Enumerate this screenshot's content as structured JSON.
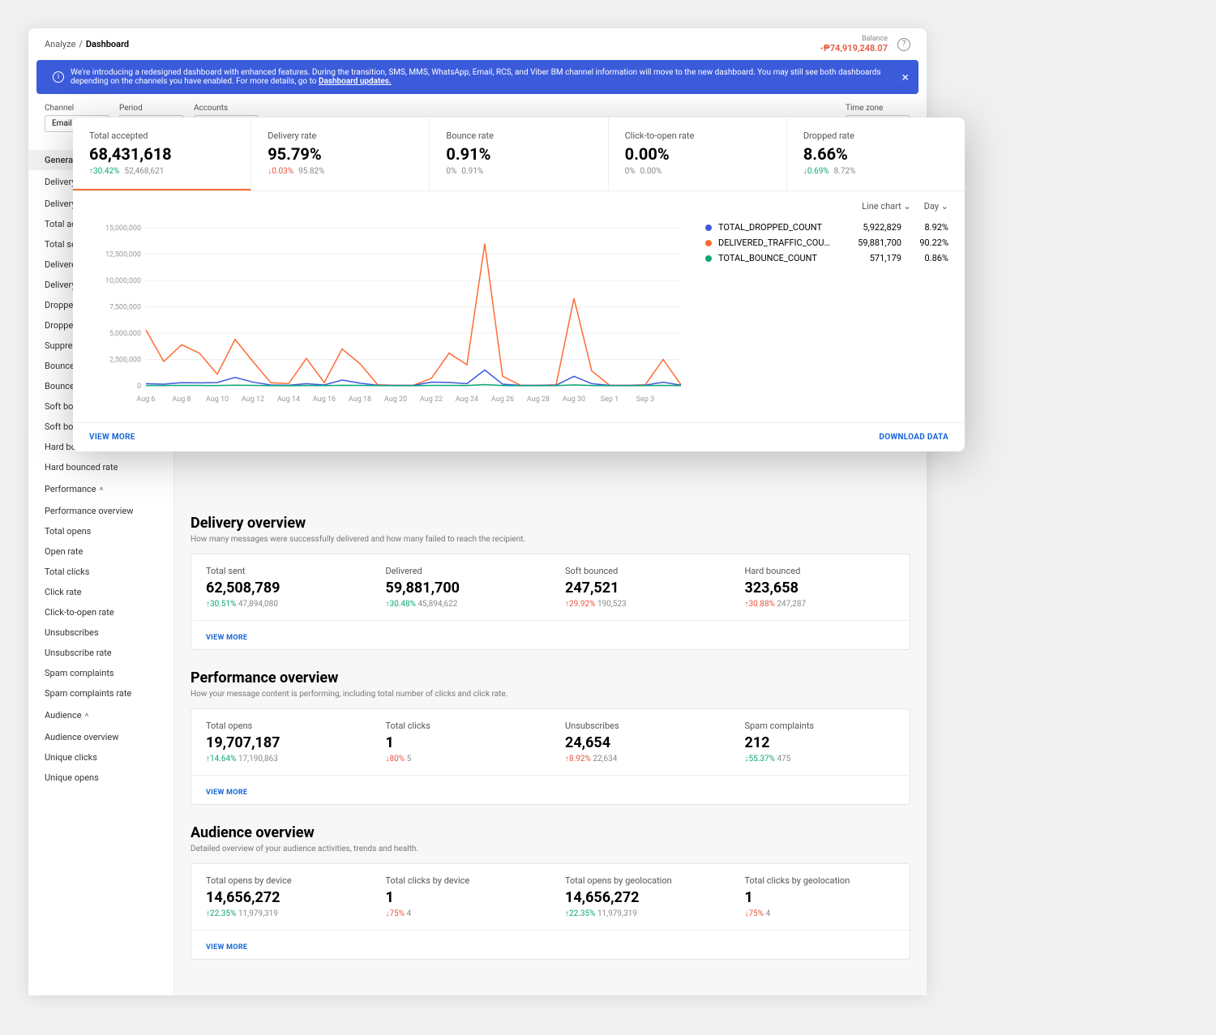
{
  "breadcrumb": {
    "parent": "Analyze",
    "current": "Dashboard"
  },
  "balance": {
    "label": "Balance",
    "value": "-₱74,919,248.07"
  },
  "banner": {
    "text": "We're introducing a redesigned dashboard with enhanced features. During the transition, SMS, MMS, WhatsApp, Email, RCS, and Viber BM channel information will move to the new dashboard. You may still see both dashboards depending on the channels you have enabled. For more details, go to ",
    "link": "Dashboard updates."
  },
  "filters": {
    "channel_label": "Channel",
    "channel_value": "Email",
    "period_label": "Period",
    "accounts_label": "Accounts",
    "tz_label": "Time zone"
  },
  "sidebar": {
    "general": "General overview",
    "g_delivery": "Delivery",
    "items_delivery": [
      "Delivery overview",
      "Total accepted",
      "Total sent",
      "Delivered",
      "Delivery rate",
      "Dropped",
      "Dropped rate",
      "Suppressed",
      "Bounced",
      "Bounced rate",
      "Soft bounced",
      "Soft bounced rate",
      "Hard bounced",
      "Hard bounced rate"
    ],
    "g_performance": "Performance",
    "items_performance": [
      "Performance overview",
      "Total opens",
      "Open rate",
      "Total clicks",
      "Click rate",
      "Click-to-open rate",
      "Unsubscribes",
      "Unsubscribe rate",
      "Spam complaints",
      "Spam complaints rate"
    ],
    "g_audience": "Audience",
    "items_audience": [
      "Audience overview",
      "Unique clicks",
      "Unique opens"
    ]
  },
  "kpis": [
    {
      "label": "Total accepted",
      "value": "68,431,618",
      "delta": "↑30.42%",
      "dir": "up",
      "prev": "52,468,621"
    },
    {
      "label": "Delivery rate",
      "value": "95.79%",
      "delta": "↓0.03%",
      "dir": "down",
      "prev": "95.82%"
    },
    {
      "label": "Bounce rate",
      "value": "0.91%",
      "delta": "0%",
      "dir": "flat",
      "prev": "0.91%"
    },
    {
      "label": "Click-to-open rate",
      "value": "0.00%",
      "delta": "0%",
      "dir": "flat",
      "prev": "0.00%"
    },
    {
      "label": "Dropped rate",
      "value": "8.66%",
      "delta": "↓0.69%",
      "dir": "up",
      "prev": "8.72%"
    }
  ],
  "chart_controls": {
    "type": "Line chart",
    "granularity": "Day"
  },
  "legend": [
    {
      "color": "#3b5bdb",
      "name": "TOTAL_DROPPED_COUNT",
      "val": "5,922,829",
      "pct": "8.92%"
    },
    {
      "color": "#ff6b35",
      "name": "DELIVERED_TRAFFIC_COU...",
      "val": "59,881,700",
      "pct": "90.22%"
    },
    {
      "color": "#0ca678",
      "name": "TOTAL_BOUNCE_COUNT",
      "val": "571,179",
      "pct": "0.86%"
    }
  ],
  "chart_footer": {
    "view": "VIEW MORE",
    "download": "DOWNLOAD DATA"
  },
  "chart_data": {
    "type": "line",
    "title": "",
    "xlabel": "",
    "ylabel": "",
    "ylim": [
      0,
      15000000
    ],
    "yticks": [
      "0",
      "2,500,000",
      "5,000,000",
      "7,500,000",
      "10,000,000",
      "12,500,000",
      "15,000,000"
    ],
    "categories": [
      "Aug 6",
      "Aug 8",
      "Aug 10",
      "Aug 12",
      "Aug 14",
      "Aug 16",
      "Aug 18",
      "Aug 20",
      "Aug 22",
      "Aug 24",
      "Aug 26",
      "Aug 28",
      "Aug 30",
      "Sep 1",
      "Sep 3"
    ],
    "series": [
      {
        "name": "DELIVERED_TRAFFIC_COUNT",
        "color": "#ff6b35",
        "values": [
          5300000,
          2300000,
          3900000,
          3100000,
          1100000,
          4400000,
          2300000,
          300000,
          200000,
          2600000,
          300000,
          3500000,
          2100000,
          100000,
          50000,
          50000,
          700000,
          3100000,
          2000000,
          13500000,
          900000,
          50000,
          50000,
          100000,
          8300000,
          1400000,
          50000,
          50000,
          100000,
          2500000,
          100000
        ]
      },
      {
        "name": "TOTAL_DROPPED_COUNT",
        "color": "#3b5bdb",
        "values": [
          200000,
          150000,
          300000,
          280000,
          310000,
          800000,
          350000,
          80000,
          50000,
          200000,
          80000,
          550000,
          250000,
          50000,
          40000,
          40000,
          350000,
          320000,
          200000,
          1500000,
          150000,
          40000,
          40000,
          60000,
          900000,
          200000,
          40000,
          40000,
          60000,
          350000,
          60000
        ]
      },
      {
        "name": "TOTAL_BOUNCE_COUNT",
        "color": "#0ca678",
        "values": [
          30000,
          25000,
          40000,
          35000,
          30000,
          60000,
          40000,
          20000,
          10000,
          30000,
          20000,
          50000,
          35000,
          15000,
          10000,
          10000,
          40000,
          35000,
          25000,
          120000,
          25000,
          10000,
          10000,
          15000,
          90000,
          30000,
          10000,
          10000,
          15000,
          40000,
          15000
        ]
      }
    ]
  },
  "sections": {
    "delivery": {
      "title": "Delivery overview",
      "desc": "How many messages were successfully delivered and how many failed to reach the recipient.",
      "cells": [
        {
          "label": "Total sent",
          "value": "62,508,789",
          "delta": "↑30.51%",
          "dir": "up",
          "prev": "47,894,080"
        },
        {
          "label": "Delivered",
          "value": "59,881,700",
          "delta": "↑30.48%",
          "dir": "up",
          "prev": "45,894,622"
        },
        {
          "label": "Soft bounced",
          "value": "247,521",
          "delta": "↑29.92%",
          "dir": "down",
          "prev": "190,523"
        },
        {
          "label": "Hard bounced",
          "value": "323,658",
          "delta": "↑30.88%",
          "dir": "down",
          "prev": "247,287"
        }
      ],
      "more": "VIEW MORE"
    },
    "performance": {
      "title": "Performance overview",
      "desc": "How your message content is performing, including total number of clicks and click rate.",
      "cells": [
        {
          "label": "Total opens",
          "value": "19,707,187",
          "delta": "↑14.64%",
          "dir": "up",
          "prev": "17,190,863"
        },
        {
          "label": "Total clicks",
          "value": "1",
          "delta": "↓80%",
          "dir": "down",
          "prev": "5"
        },
        {
          "label": "Unsubscribes",
          "value": "24,654",
          "delta": "↑8.92%",
          "dir": "down",
          "prev": "22,634"
        },
        {
          "label": "Spam complaints",
          "value": "212",
          "delta": "↓55.37%",
          "dir": "up",
          "prev": "475"
        }
      ],
      "more": "VIEW MORE"
    },
    "audience": {
      "title": "Audience overview",
      "desc": "Detailed overview of your audience activities, trends and health.",
      "cells": [
        {
          "label": "Total opens by device",
          "value": "14,656,272",
          "delta": "↑22.35%",
          "dir": "up",
          "prev": "11,979,319"
        },
        {
          "label": "Total clicks by device",
          "value": "1",
          "delta": "↓75%",
          "dir": "down",
          "prev": "4"
        },
        {
          "label": "Total opens by geolocation",
          "value": "14,656,272",
          "delta": "↑22.35%",
          "dir": "up",
          "prev": "11,979,319"
        },
        {
          "label": "Total clicks by geolocation",
          "value": "1",
          "delta": "↓75%",
          "dir": "down",
          "prev": "4"
        }
      ],
      "more": "VIEW MORE"
    }
  }
}
